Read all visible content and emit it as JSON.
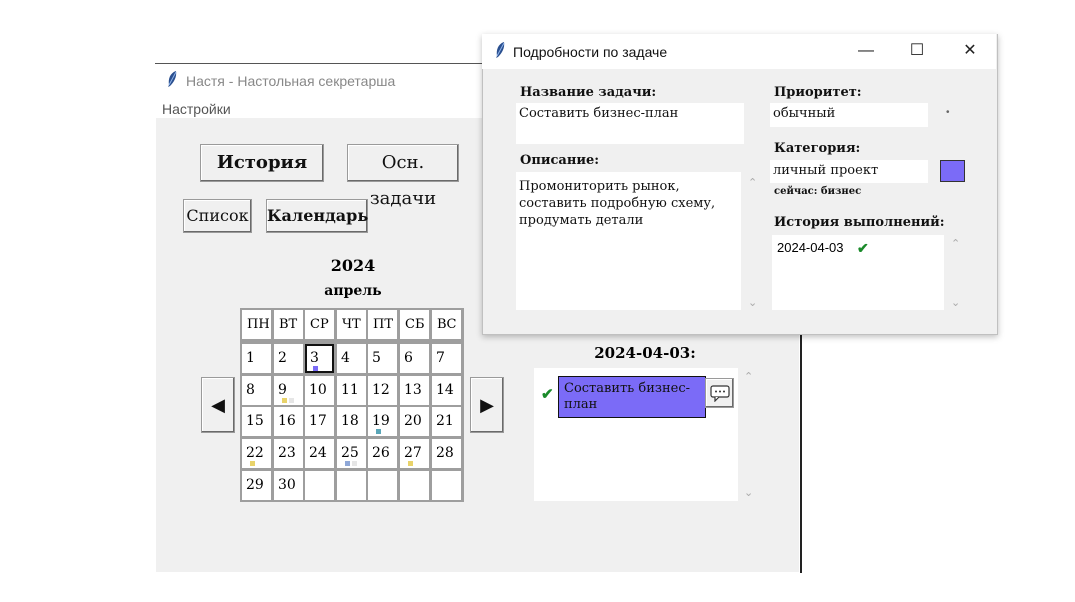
{
  "main_window": {
    "title": "Настя - Настольная секретарша",
    "menu": {
      "settings": "Настройки"
    },
    "buttons": {
      "history": "История",
      "main_tasks": "Осн. задачи",
      "list": "Список",
      "calendar": "Календарь"
    },
    "calendar": {
      "year": "2024",
      "month": "апрель",
      "weekdays": [
        "ПН",
        "ВТ",
        "СР",
        "ЧТ",
        "ПТ",
        "СБ",
        "ВС"
      ],
      "days": [
        "1",
        "2",
        "3",
        "4",
        "5",
        "6",
        "7",
        "8",
        "9",
        "10",
        "11",
        "12",
        "13",
        "14",
        "15",
        "16",
        "17",
        "18",
        "19",
        "20",
        "21",
        "22",
        "23",
        "24",
        "25",
        "26",
        "27",
        "28",
        "29",
        "30"
      ],
      "selected_day": "3",
      "markers": {
        "3": [
          "#7b6bf7"
        ],
        "9": [
          "#e9d36a",
          "#e6e6e6"
        ],
        "19": [
          "#5aa6b8"
        ],
        "22": [
          "#e9d36a"
        ],
        "25": [
          "#8fa8d8",
          "#e6e6e6"
        ],
        "27": [
          "#e9d36a"
        ]
      },
      "prev_icon": "◀",
      "next_icon": "▶"
    },
    "day_view": {
      "date_title": "2024-04-03:",
      "tasks": [
        {
          "text": "Составить бизнес-план",
          "done": true,
          "color": "#7b6bf7",
          "check_icon": "✔"
        }
      ]
    }
  },
  "task_dialog": {
    "title": "Подробности по задаче",
    "controls": {
      "minimize": "—",
      "maximize": "☐",
      "close": "✕"
    },
    "name_label": "Название задачи:",
    "name_value": "Составить бизнес-план",
    "description_label": "Описание:",
    "description_value": "Промониторить рынок,\nсоставить подробную схему,\nпродумать детали",
    "priority_label": "Приоритет:",
    "priority_value": "обычный",
    "category_label": "Категория:",
    "category_value": "личный проект",
    "category_color": "#7b6bf7",
    "category_current": "сейчас: бизнес",
    "history_label": "История выполнений:",
    "history": [
      {
        "date": "2024-04-03",
        "check_icon": "✔"
      }
    ]
  }
}
